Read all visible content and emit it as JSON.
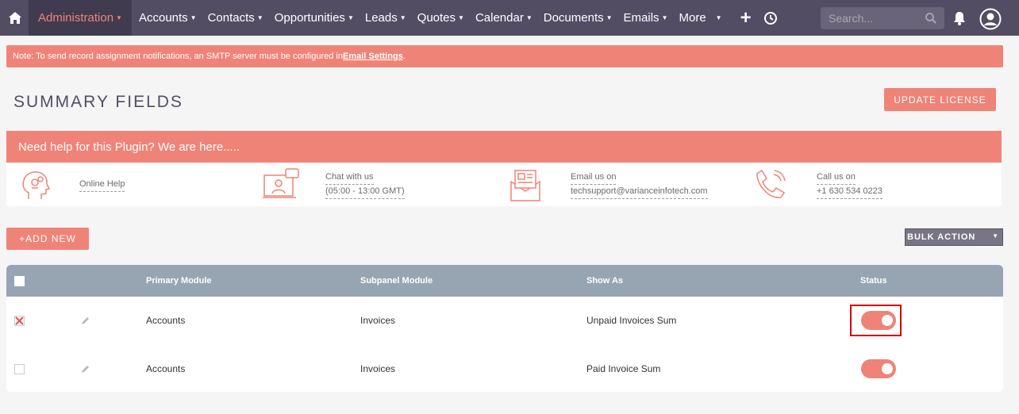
{
  "nav": {
    "items": [
      {
        "label": "Administration",
        "active": true
      },
      {
        "label": "Accounts"
      },
      {
        "label": "Contacts"
      },
      {
        "label": "Opportunities"
      },
      {
        "label": "Leads"
      },
      {
        "label": "Quotes"
      },
      {
        "label": "Calendar"
      },
      {
        "label": "Documents"
      },
      {
        "label": "Emails"
      },
      {
        "label": "More"
      }
    ],
    "search_placeholder": "Search...",
    "icons": [
      "home-icon",
      "plus-icon",
      "history-icon",
      "search-icon",
      "bell-icon",
      "user-icon"
    ]
  },
  "notice": {
    "text": "Note: To send record assignment notifications, an SMTP server must be configured in ",
    "link": "Email Settings",
    "suffix": "."
  },
  "page": {
    "title": "SUMMARY FIELDS",
    "update_license": "UPDATE LICENSE"
  },
  "help": {
    "heading": "Need help for this Plugin? We are here.....",
    "online": "Online Help",
    "chat_label": "Chat with us",
    "chat_hours": "(05:00 - 13:00 GMT)",
    "email_label": "Email us on",
    "email": "techsupport@varianceinfotech.com",
    "call_label": "Call us on",
    "phone": "+1 630 534 0223"
  },
  "actions": {
    "add_new": "+ADD NEW",
    "bulk_action": "BULK ACTION"
  },
  "table": {
    "headers": [
      "Primary Module",
      "Subpanel Module",
      "Show As",
      "Status"
    ],
    "rows": [
      {
        "primary": "Accounts",
        "subpanel": "Invoices",
        "show_as": "Unpaid Invoices Sum",
        "status": true,
        "selected": true
      },
      {
        "primary": "Accounts",
        "subpanel": "Invoices",
        "show_as": "Paid Invoice Sum",
        "status": true,
        "selected": false
      }
    ]
  },
  "colors": {
    "accent": "#f08377",
    "nav_bg": "#534d64",
    "table_head": "#97a5b2"
  }
}
